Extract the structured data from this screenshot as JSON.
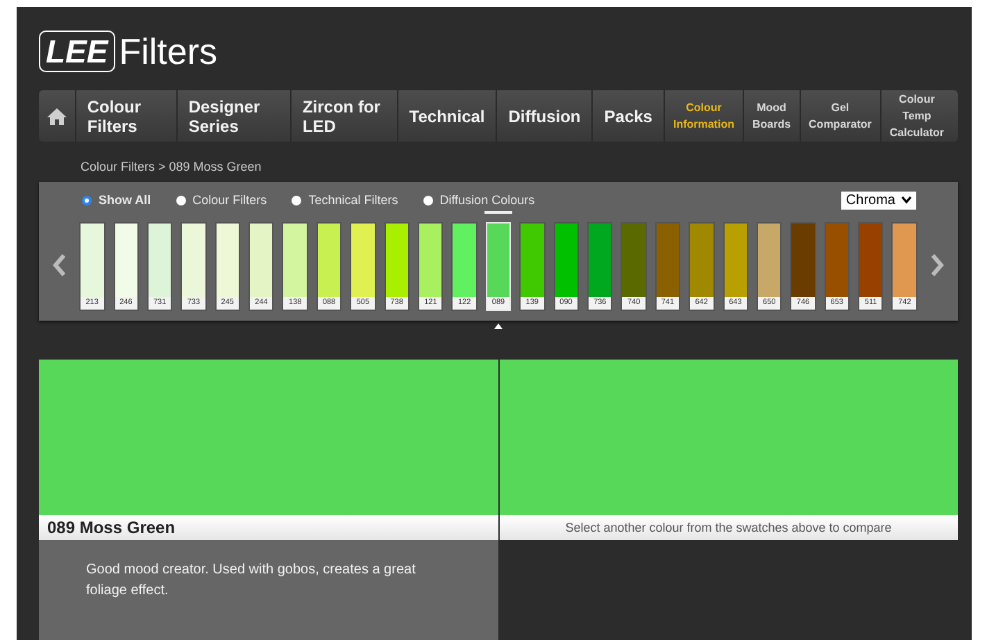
{
  "logo": {
    "mark": "LEE",
    "name": "Filters"
  },
  "nav": {
    "main": [
      {
        "label": "Colour Filters"
      },
      {
        "label": "Designer Series"
      },
      {
        "label": "Zircon for LED"
      },
      {
        "label": "Technical"
      },
      {
        "label": "Diffusion"
      },
      {
        "label": "Packs"
      }
    ],
    "tools": [
      {
        "label": "Colour Information",
        "selected": true
      },
      {
        "label": "Mood Boards",
        "selected": false
      },
      {
        "label": "Gel Comparator",
        "selected": false
      },
      {
        "label": "Colour Temp Calculator",
        "selected": false
      }
    ]
  },
  "breadcrumb": "Colour Filters > 089 Moss Green",
  "filters": [
    {
      "label": "Show All",
      "selected": true
    },
    {
      "label": "Colour Filters",
      "selected": false
    },
    {
      "label": "Technical Filters",
      "selected": false
    },
    {
      "label": "Diffusion Colours",
      "selected": false
    }
  ],
  "sort": {
    "value": "Chroma"
  },
  "swatches": [
    {
      "code": "213",
      "color": "#e6f7dc",
      "selected": false
    },
    {
      "code": "246",
      "color": "#f2fbe8",
      "selected": false
    },
    {
      "code": "731",
      "color": "#def4d8",
      "selected": false
    },
    {
      "code": "733",
      "color": "#ecf6d8",
      "selected": false
    },
    {
      "code": "245",
      "color": "#eef8d6",
      "selected": false
    },
    {
      "code": "244",
      "color": "#e4f4c4",
      "selected": false
    },
    {
      "code": "138",
      "color": "#d4f5a0",
      "selected": false
    },
    {
      "code": "088",
      "color": "#c8f050",
      "selected": false
    },
    {
      "code": "505",
      "color": "#dff050",
      "selected": false
    },
    {
      "code": "738",
      "color": "#a8f000",
      "selected": false
    },
    {
      "code": "121",
      "color": "#a8f060",
      "selected": false
    },
    {
      "code": "122",
      "color": "#60f060",
      "selected": false
    },
    {
      "code": "089",
      "color": "#58d858",
      "selected": true
    },
    {
      "code": "139",
      "color": "#40c800",
      "selected": false
    },
    {
      "code": "090",
      "color": "#00c000",
      "selected": false
    },
    {
      "code": "736",
      "color": "#00a820",
      "selected": false
    },
    {
      "code": "740",
      "color": "#5a6a00",
      "selected": false
    },
    {
      "code": "741",
      "color": "#8a6000",
      "selected": false
    },
    {
      "code": "642",
      "color": "#a08800",
      "selected": false
    },
    {
      "code": "643",
      "color": "#b8a000",
      "selected": false
    },
    {
      "code": "650",
      "color": "#c8a868",
      "selected": false
    },
    {
      "code": "746",
      "color": "#6a3c00",
      "selected": false
    },
    {
      "code": "653",
      "color": "#985000",
      "selected": false
    },
    {
      "code": "511",
      "color": "#984000",
      "selected": false
    },
    {
      "code": "742",
      "color": "#e09850",
      "selected": false
    }
  ],
  "selected_filter": {
    "name": "089 Moss Green",
    "description": "Good mood creator. Used with gobos, creates a great foliage effect."
  },
  "compare": {
    "hint": "Select another colour from the swatches above to compare"
  }
}
